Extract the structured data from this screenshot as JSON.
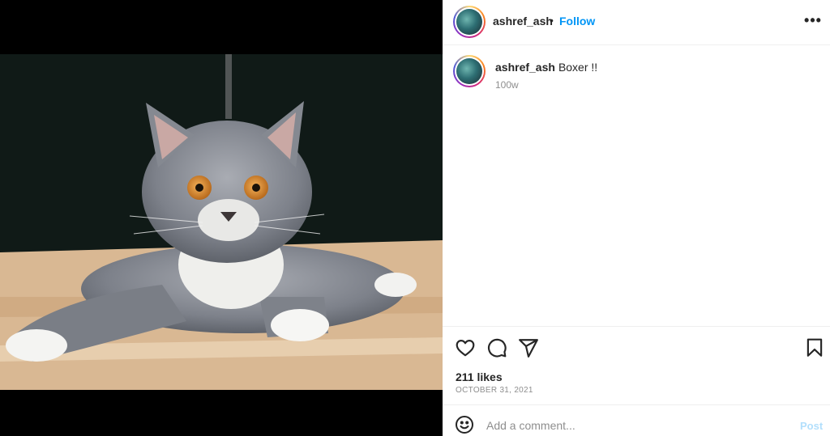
{
  "post": {
    "author": "ashref_ash",
    "separator": "•",
    "follow_label": "Follow",
    "more_icon": "more-horizontal-icon",
    "more_glyph": "•••"
  },
  "caption": {
    "username": "ashref_ash",
    "text": "Boxer !!",
    "age": "100w"
  },
  "engagement": {
    "likes": "211 likes",
    "date": "OCTOBER 31, 2021"
  },
  "comment": {
    "placeholder": "Add a comment...",
    "post_label": "Post"
  },
  "icons": {
    "like": "heart-icon",
    "comment": "comment-bubble-icon",
    "share": "paper-plane-icon",
    "save": "bookmark-icon",
    "emoji": "smiley-icon"
  },
  "colors": {
    "accent": "#0095f6",
    "post_disabled": "#b2dffc",
    "muted": "#8e8e8e",
    "text": "#262626"
  }
}
